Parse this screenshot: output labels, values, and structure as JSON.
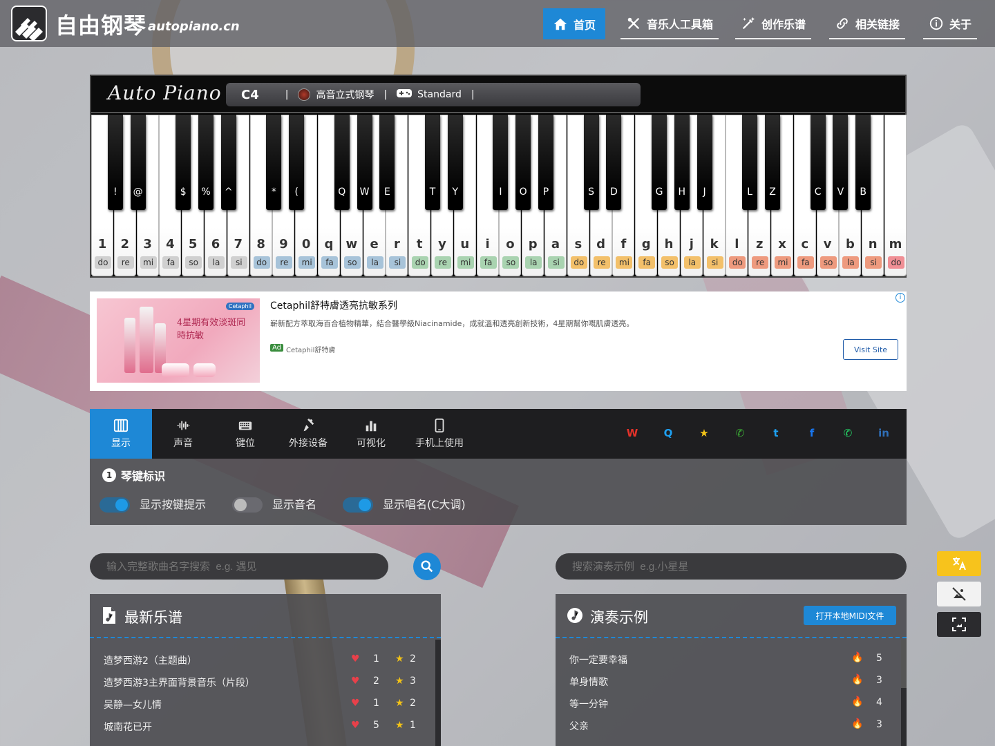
{
  "site": {
    "name": "自由钢琴",
    "domain": "autopiano.cn"
  },
  "nav": [
    {
      "label": "首页",
      "icon": "home-icon",
      "active": true
    },
    {
      "label": "音乐人工具箱",
      "icon": "tools-icon"
    },
    {
      "label": "创作乐谱",
      "icon": "magic-wand-icon"
    },
    {
      "label": "相关链接",
      "icon": "link-icon"
    },
    {
      "label": "关于",
      "icon": "info-icon"
    }
  ],
  "piano": {
    "brand": "Auto Piano",
    "status": {
      "note": "C4",
      "sep": "|",
      "instrument": "高音立式钢琴",
      "mode": "Standard"
    },
    "white_keys": [
      {
        "key": "1",
        "sol": "do"
      },
      {
        "key": "2",
        "sol": "re"
      },
      {
        "key": "3",
        "sol": "mi"
      },
      {
        "key": "4",
        "sol": "fa"
      },
      {
        "key": "5",
        "sol": "so"
      },
      {
        "key": "6",
        "sol": "la"
      },
      {
        "key": "7",
        "sol": "si"
      },
      {
        "key": "8",
        "sol": "do"
      },
      {
        "key": "9",
        "sol": "re"
      },
      {
        "key": "0",
        "sol": "mi"
      },
      {
        "key": "q",
        "sol": "fa"
      },
      {
        "key": "w",
        "sol": "so"
      },
      {
        "key": "e",
        "sol": "la"
      },
      {
        "key": "r",
        "sol": "si"
      },
      {
        "key": "t",
        "sol": "do"
      },
      {
        "key": "y",
        "sol": "re"
      },
      {
        "key": "u",
        "sol": "mi"
      },
      {
        "key": "i",
        "sol": "fa"
      },
      {
        "key": "o",
        "sol": "so"
      },
      {
        "key": "p",
        "sol": "la"
      },
      {
        "key": "a",
        "sol": "si"
      },
      {
        "key": "s",
        "sol": "do"
      },
      {
        "key": "d",
        "sol": "re"
      },
      {
        "key": "f",
        "sol": "mi"
      },
      {
        "key": "g",
        "sol": "fa"
      },
      {
        "key": "h",
        "sol": "so"
      },
      {
        "key": "j",
        "sol": "la"
      },
      {
        "key": "k",
        "sol": "si"
      },
      {
        "key": "l",
        "sol": "do"
      },
      {
        "key": "z",
        "sol": "re"
      },
      {
        "key": "x",
        "sol": "mi"
      },
      {
        "key": "c",
        "sol": "fa"
      },
      {
        "key": "v",
        "sol": "so"
      },
      {
        "key": "b",
        "sol": "la"
      },
      {
        "key": "n",
        "sol": "si"
      },
      {
        "key": "m",
        "sol": "do"
      }
    ],
    "octave_colors": [
      "#d0d0d0",
      "#a7c3d9",
      "#a9d3b0",
      "#f3c06a",
      "#ee9a7e",
      "#f08f95"
    ],
    "black_keys": [
      "!",
      "@",
      "$",
      "%",
      "^",
      "*",
      "(",
      "Q",
      "W",
      "E",
      "T",
      "Y",
      "I",
      "O",
      "P",
      "S",
      "D",
      "G",
      "H",
      "J",
      "L",
      "Z",
      "C",
      "V",
      "B"
    ]
  },
  "ad": {
    "title": "Cetaphil舒特膚透亮抗敏系列",
    "desc": "嶄新配方萃取海百合植物精華，結合醫學級Niacinamide，成就溫和透亮創新技術，4星期幫你嘅肌膚透亮。",
    "badge": "Ad",
    "source": "Cetaphil舒特膚",
    "button": "Visit Site",
    "image_text": "4星期有效淡斑同時抗敏",
    "image_brand": "Cetaphil"
  },
  "tabs": [
    {
      "label": "显示",
      "icon": "piano-keys-icon",
      "active": true
    },
    {
      "label": "声音",
      "icon": "sound-wave-icon"
    },
    {
      "label": "键位",
      "icon": "keyboard-icon"
    },
    {
      "label": "外接设备",
      "icon": "plug-icon"
    },
    {
      "label": "可视化",
      "icon": "bar-chart-icon"
    },
    {
      "label": "手机上使用",
      "icon": "mobile-icon"
    }
  ],
  "social": [
    {
      "name": "weibo-icon",
      "glyph": "W",
      "color": "#e6322a"
    },
    {
      "name": "qq-icon",
      "glyph": "Q",
      "color": "#1ea0f0"
    },
    {
      "name": "qzone-icon",
      "glyph": "★",
      "color": "#f5c518"
    },
    {
      "name": "wechat-icon",
      "glyph": "✆",
      "color": "#3cb035"
    },
    {
      "name": "twitter-icon",
      "glyph": "t",
      "color": "#1da1f2"
    },
    {
      "name": "facebook-icon",
      "glyph": "f",
      "color": "#1877f2"
    },
    {
      "name": "whatsapp-icon",
      "glyph": "✆",
      "color": "#25d366"
    },
    {
      "name": "linkedin-icon",
      "glyph": "in",
      "color": "#2f6fb8"
    }
  ],
  "display_settings": {
    "number": "1",
    "title": "琴键标识",
    "toggles": [
      {
        "label": "显示按键提示",
        "on": true
      },
      {
        "label": "显示音名",
        "on": false
      },
      {
        "label": "显示唱名(C大调)",
        "on": true
      }
    ]
  },
  "search": {
    "song_placeholder": "输入完整歌曲名字搜索  e.g. 遇见",
    "demo_placeholder": "搜索演奏示例  e.g.小星星"
  },
  "latest_scores": {
    "title": "最新乐谱",
    "rows": [
      {
        "name": "造梦西游2（主题曲）",
        "likes": "1",
        "stars": "2"
      },
      {
        "name": "造梦西游3主界面背景音乐（片段）",
        "likes": "2",
        "stars": "3"
      },
      {
        "name": "吴静—女儿情",
        "likes": "1",
        "stars": "2"
      },
      {
        "name": "城南花已开",
        "likes": "5",
        "stars": "1"
      }
    ]
  },
  "demos": {
    "title": "演奏示例",
    "button": "打开本地MIDI文件",
    "rows": [
      {
        "name": "你一定要幸福",
        "hot": "5"
      },
      {
        "name": "单身情歌",
        "hot": "3"
      },
      {
        "name": "等一分钟",
        "hot": "4"
      },
      {
        "name": "父亲",
        "hot": "3"
      }
    ]
  },
  "float_tools": [
    {
      "name": "translate-button",
      "icon": "translate-icon",
      "bg": "#f7c31c"
    },
    {
      "name": "hide-background-button",
      "icon": "image-off-icon",
      "bg": "#f2f2f2"
    },
    {
      "name": "fullscreen-button",
      "icon": "fullscreen-icon",
      "bg": "#2b2b2e"
    }
  ]
}
